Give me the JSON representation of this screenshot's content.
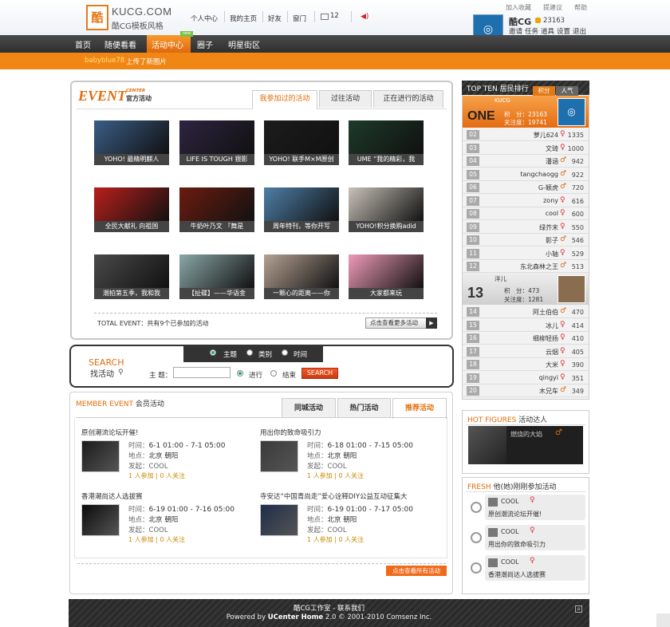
{
  "header": {
    "logo_mark": "酷",
    "logo_title": "KUCG.COM",
    "logo_subtitle": "酷CG模板风格",
    "top_links": [
      "个人中心",
      "我的主页",
      "好友",
      "窗门"
    ],
    "message_count": "12",
    "util_links": [
      "加入收藏",
      "提建议",
      "帮助"
    ],
    "user": {
      "name": "酷CG",
      "points": "23163",
      "links": [
        "邀请",
        "任务",
        "道具",
        "设置",
        "退出"
      ]
    }
  },
  "nav": {
    "items": [
      "首页",
      "随便看看",
      "活动中心",
      "圈子",
      "明星街区"
    ],
    "active": "活动中心",
    "new_badge": "new",
    "notice_user": "babyblue78",
    "notice_text": "上传了新图片"
  },
  "event_center": {
    "logo": "EVENT",
    "logo_small": "CENTER",
    "logo_cn": "官方活动",
    "tabs": [
      "我参加过的活动",
      "过往活动",
      "正在进行的活动"
    ],
    "events": [
      {
        "caption": "YOHO! 最精明麒人",
        "color": "#3a5d86"
      },
      {
        "caption": "LIFE IS TOUGH 猥影",
        "color": "#2d2440"
      },
      {
        "caption": "YOHO! 联手M×M原创",
        "color": "#1c1c1c"
      },
      {
        "caption": "UME “我的精彩，我",
        "color": "#1d3a2a"
      },
      {
        "caption": "全民大献礼 向祖国",
        "color": "#b8201c"
      },
      {
        "caption": "牛奶叶乃文 『舞是",
        "color": "#6b1c10"
      },
      {
        "caption": "周年特刊，等你开写",
        "color": "#4e7fa8"
      },
      {
        "caption": "YOHO!积分换购adid",
        "color": "#c8c2b8"
      },
      {
        "caption": "潮拍第五季，我和我",
        "color": "#4a4a4a"
      },
      {
        "caption": "【扯碟】——华语金",
        "color": "#8aa7a8"
      },
      {
        "caption": "一颗心的距离——你",
        "color": "#b5a294"
      },
      {
        "caption": "大家都来玩",
        "color": "#f09ab8"
      }
    ],
    "total": "TOTAL EVENT：共有9个已参加的活动",
    "more": "点击查看更多活动"
  },
  "search": {
    "title": "SEARCH",
    "subtitle": "找活动",
    "filters": [
      "主题",
      "类别",
      "时间"
    ],
    "keyword_label": "主 题：",
    "keyword_value": "",
    "status": [
      "进行",
      "结束"
    ],
    "button": "SEARCH"
  },
  "member_events": {
    "title_en": "MEMBER EVENT",
    "title_cn": "会员活动",
    "tabs": [
      "同城活动",
      "热门活动",
      "推荐活动"
    ],
    "items": [
      {
        "title": "原创潮流论坛开催!",
        "time": "6-1 01:00 - 7-1 05:00",
        "place": "北京 朝阳",
        "organizer": "COOL",
        "stats": "1 人参加  |  0 人关注"
      },
      {
        "title": "用出你的致命吸引力",
        "time": "6-18 01:00 - 7-15 05:00",
        "place": "北京 朝阳",
        "organizer": "COOL",
        "stats": "1 人参加  |  0 人关注"
      },
      {
        "title": "香港潮尚达人选拔赛",
        "time": "6-19 01:00 - 7-16 05:00",
        "place": "北京 朝阳",
        "organizer": "COOL",
        "stats": "1 人参加  |  0 人关注"
      },
      {
        "title": "寺安达“中国青尚走”爱心诠释DIY公益互动征集大",
        "time": "6-19 01:00 - 7-17 05:00",
        "place": "北京 朝阳",
        "organizer": "COOL",
        "stats": "1 人参加  |  0 人关注"
      }
    ],
    "labels": {
      "time": "时间：",
      "place": "地点：",
      "organizer": "发起："
    },
    "more": "点击查看所有活动"
  },
  "top_ten": {
    "title": "TOP TEN 居民排行",
    "tabs": [
      "积分",
      "人气"
    ],
    "first": {
      "name": "KUCG",
      "rank": "ONE",
      "points": "积　分：23163",
      "followers": "关注度：19741"
    },
    "rows": [
      {
        "rank": "02",
        "name": "萝儿624",
        "sex": "♀",
        "score": "1335"
      },
      {
        "rank": "03",
        "name": "文琦",
        "sex": "♀",
        "score": "1000"
      },
      {
        "rank": "04",
        "name": "潘涵",
        "sex": "♂",
        "score": "942"
      },
      {
        "rank": "05",
        "name": "tangchaogg",
        "sex": "♂",
        "score": "922"
      },
      {
        "rank": "06",
        "name": "G-颖虎",
        "sex": "♂",
        "score": "720"
      },
      {
        "rank": "07",
        "name": "zony",
        "sex": "♀",
        "score": "616"
      },
      {
        "rank": "08",
        "name": "cool",
        "sex": "♀",
        "score": "600"
      },
      {
        "rank": "09",
        "name": "绿芥末",
        "sex": "♀",
        "score": "550"
      },
      {
        "rank": "10",
        "name": "影子",
        "sex": "♂",
        "score": "546"
      },
      {
        "rank": "11",
        "name": "小轴",
        "sex": "♀",
        "score": "529"
      },
      {
        "rank": "12",
        "name": "东北森林之王",
        "sex": "♂",
        "score": "513"
      }
    ],
    "thirteen": {
      "name": "洋儿",
      "rank": "13",
      "points": "积　分：473",
      "followers": "关注度：1281"
    },
    "rows2": [
      {
        "rank": "14",
        "name": "阿土伯伯",
        "sex": "♂",
        "score": "470"
      },
      {
        "rank": "15",
        "name": "冰儿",
        "sex": "♀",
        "score": "414"
      },
      {
        "rank": "16",
        "name": "细柳轻扬",
        "sex": "♀",
        "score": "410"
      },
      {
        "rank": "17",
        "name": "云烟",
        "sex": "♀",
        "score": "405"
      },
      {
        "rank": "18",
        "name": "大米",
        "sex": "♀",
        "score": "390"
      },
      {
        "rank": "19",
        "name": "qingyi",
        "sex": "♀",
        "score": "351"
      },
      {
        "rank": "20",
        "name": "木兄车",
        "sex": "♂",
        "score": "349"
      }
    ]
  },
  "hot_figures": {
    "title_en": "HOT FIGURES",
    "title_cn": "活动达人",
    "name": "燃烧的大焰",
    "sex": "♂"
  },
  "fresh": {
    "title_en": "FRESH",
    "title_cn": "他(她)刚刚参加活动",
    "items": [
      {
        "name": "COOL",
        "sex": "♀",
        "text": "原创潮流论坛开催!"
      },
      {
        "name": "COOL",
        "sex": "♀",
        "text": "用出你的致命吸引力"
      },
      {
        "name": "COOL",
        "sex": "♀",
        "text": "香港潮尚达人选拔赛"
      }
    ]
  },
  "footer": {
    "line1": "酷CG工作室 - 联系我们",
    "line2_prefix": "Powered by ",
    "line2_brand": "UCenter Home",
    "line2_suffix": " 2.0 © 2001-2010 Comsenz Inc."
  }
}
